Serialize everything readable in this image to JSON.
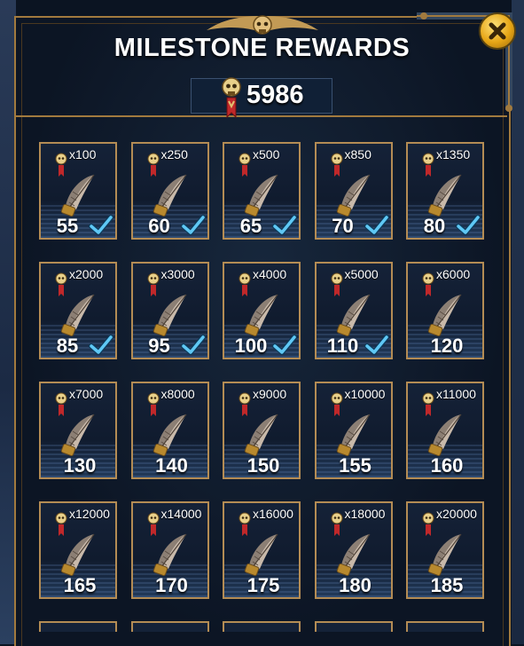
{
  "dialog": {
    "title": "MILESTONE REWARDS",
    "score": "5986",
    "close_icon": "close-x-icon",
    "score_icon": "skull-medal-icon"
  },
  "colors": {
    "frame_gold": "#a27a3e",
    "card_border": "#b48c54",
    "check_blue": "#5fc8f5",
    "close_gold": "#e6a515"
  },
  "rewards": [
    {
      "req": "x100",
      "amount": "55",
      "claimed": true
    },
    {
      "req": "x250",
      "amount": "60",
      "claimed": true
    },
    {
      "req": "x500",
      "amount": "65",
      "claimed": true
    },
    {
      "req": "x850",
      "amount": "70",
      "claimed": true
    },
    {
      "req": "x1350",
      "amount": "80",
      "claimed": true
    },
    {
      "req": "x2000",
      "amount": "85",
      "claimed": true
    },
    {
      "req": "x3000",
      "amount": "95",
      "claimed": true
    },
    {
      "req": "x4000",
      "amount": "100",
      "claimed": true
    },
    {
      "req": "x5000",
      "amount": "110",
      "claimed": true
    },
    {
      "req": "x6000",
      "amount": "120",
      "claimed": false
    },
    {
      "req": "x7000",
      "amount": "130",
      "claimed": false
    },
    {
      "req": "x8000",
      "amount": "140",
      "claimed": false
    },
    {
      "req": "x9000",
      "amount": "150",
      "claimed": false
    },
    {
      "req": "x10000",
      "amount": "155",
      "claimed": false
    },
    {
      "req": "x11000",
      "amount": "160",
      "claimed": false
    },
    {
      "req": "x12000",
      "amount": "165",
      "claimed": false
    },
    {
      "req": "x14000",
      "amount": "170",
      "claimed": false
    },
    {
      "req": "x16000",
      "amount": "175",
      "claimed": false
    },
    {
      "req": "x18000",
      "amount": "180",
      "claimed": false
    },
    {
      "req": "x20000",
      "amount": "185",
      "claimed": false
    }
  ],
  "icons": {
    "reward_item": "feather-quill-icon",
    "requirement": "skull-medal-icon",
    "claimed": "checkmark-icon"
  }
}
